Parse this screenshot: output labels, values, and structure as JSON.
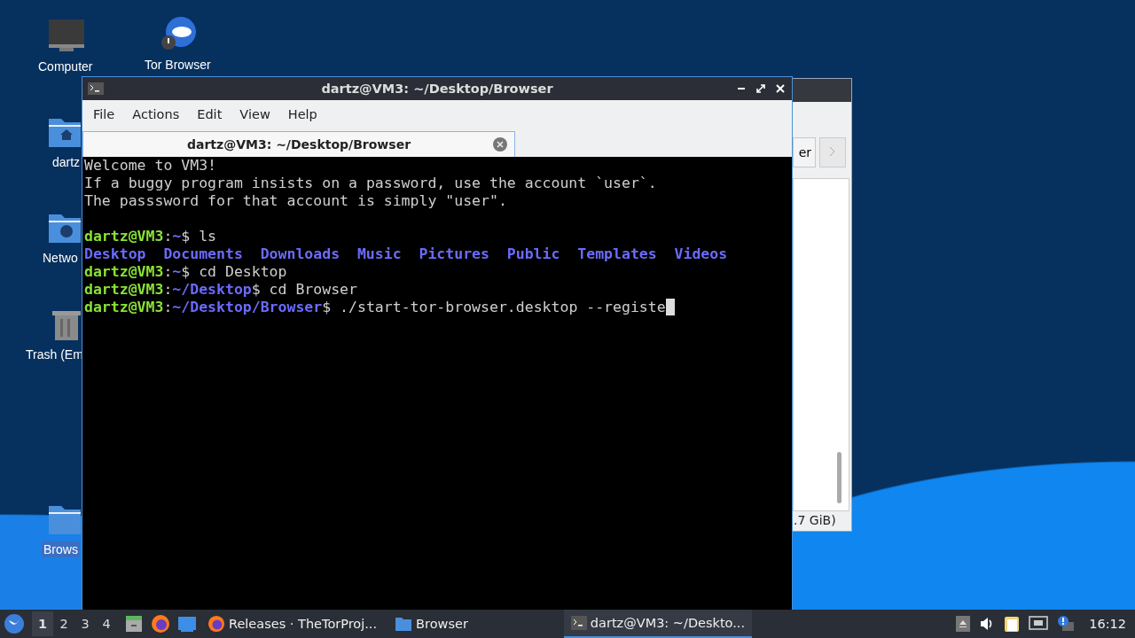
{
  "desktop": {
    "icons": [
      {
        "kind": "computer",
        "label": "Computer",
        "selected": false
      },
      {
        "kind": "app",
        "label": "Tor Browser",
        "selected": false
      },
      {
        "kind": "home",
        "label": "dartz",
        "selected": false
      },
      {
        "kind": "network",
        "label": "Netwo",
        "selected": false
      },
      {
        "kind": "trash",
        "label": "Trash (Em",
        "selected": false
      },
      {
        "kind": "folder",
        "label": "Brows",
        "selected": true
      }
    ]
  },
  "file_manager": {
    "path_button": "er",
    "status": ".7 GiB)"
  },
  "terminal": {
    "title": "dartz@VM3: ~/Desktop/Browser",
    "menu": [
      "File",
      "Actions",
      "Edit",
      "View",
      "Help"
    ],
    "tabs": [
      {
        "label": "dartz@VM3: ~/Desktop/Browser",
        "selected": true
      }
    ],
    "cursor": true,
    "lines": [
      {
        "kind": "text",
        "segments": [
          {
            "kind": "plain",
            "text": "Welcome to VM3!"
          }
        ]
      },
      {
        "kind": "text",
        "segments": [
          {
            "kind": "plain",
            "text": "If a buggy program insists on a password, use the account `user`."
          }
        ]
      },
      {
        "kind": "text",
        "segments": [
          {
            "kind": "plain",
            "text": "The passsword for that account is simply \"user\"."
          }
        ]
      },
      {
        "kind": "blank"
      },
      {
        "kind": "text",
        "segments": [
          {
            "kind": "user",
            "text": "dartz@VM3"
          },
          {
            "kind": "plain",
            "text": ":"
          },
          {
            "kind": "path",
            "text": "~"
          },
          {
            "kind": "plain",
            "text": "$ ls"
          }
        ]
      },
      {
        "kind": "listing",
        "items": [
          "Desktop",
          "Documents",
          "Downloads",
          "Music",
          "Pictures",
          "Public",
          "Templates",
          "Videos"
        ]
      },
      {
        "kind": "text",
        "segments": [
          {
            "kind": "user",
            "text": "dartz@VM3"
          },
          {
            "kind": "plain",
            "text": ":"
          },
          {
            "kind": "path",
            "text": "~"
          },
          {
            "kind": "plain",
            "text": "$ cd Desktop"
          }
        ]
      },
      {
        "kind": "text",
        "segments": [
          {
            "kind": "user",
            "text": "dartz@VM3"
          },
          {
            "kind": "plain",
            "text": ":"
          },
          {
            "kind": "path",
            "text": "~/Desktop"
          },
          {
            "kind": "plain",
            "text": "$ cd Browser"
          }
        ]
      },
      {
        "kind": "text",
        "segments": [
          {
            "kind": "user",
            "text": "dartz@VM3"
          },
          {
            "kind": "plain",
            "text": ":"
          },
          {
            "kind": "path",
            "text": "~/Desktop/Browser"
          },
          {
            "kind": "plain",
            "text": "$ ./start-tor-browser.desktop --registe"
          }
        ]
      }
    ]
  },
  "taskbar": {
    "workspaces": [
      {
        "label": "1",
        "selected": true
      },
      {
        "label": "2",
        "selected": false
      },
      {
        "label": "3",
        "selected": false
      },
      {
        "label": "4",
        "selected": false
      }
    ],
    "launchers": [
      {
        "kind": "files"
      },
      {
        "kind": "firefox"
      },
      {
        "kind": "desktop"
      }
    ],
    "tasks": [
      {
        "kind": "firefox",
        "label": "Releases · TheTorProj...",
        "selected": false
      },
      {
        "kind": "folder",
        "label": "Browser",
        "selected": false
      },
      {
        "kind": "terminal",
        "label": "dartz@VM3: ~/Deskto...",
        "selected": true
      }
    ],
    "clock": "16:12"
  }
}
